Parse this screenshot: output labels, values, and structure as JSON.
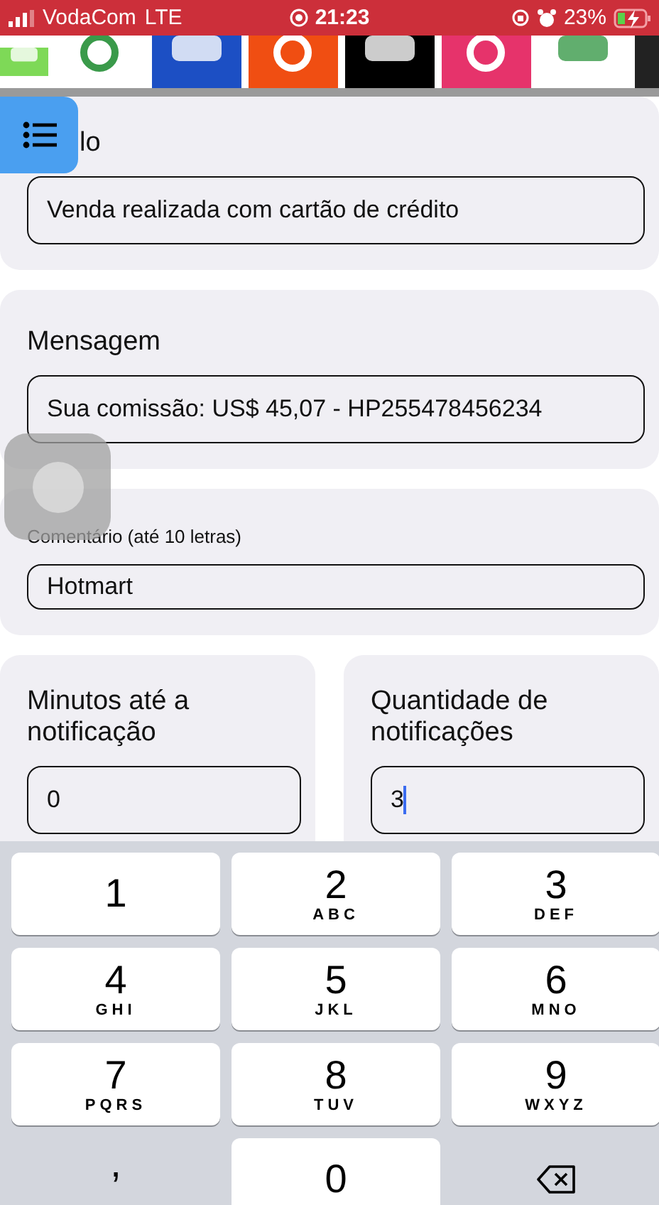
{
  "status_bar": {
    "carrier": "VodaCom",
    "network": "LTE",
    "time": "21:23",
    "battery": "23%",
    "charging": true
  },
  "app_strip": [
    {
      "color": "#7ed957"
    },
    {
      "color": "#ffffff"
    },
    {
      "color": "#1c4fc4"
    },
    {
      "color": "#f04e12"
    },
    {
      "color": "#000000"
    },
    {
      "color": "#e6336b"
    },
    {
      "color": "#ffffff"
    },
    {
      "color": "#222222"
    }
  ],
  "sections": [
    {
      "label": "lo",
      "kind": "title",
      "fields": [
        {
          "value": "Venda realizada com cartão de crédito",
          "focused": false
        }
      ]
    },
    {
      "label": "Mensagem",
      "kind": "title",
      "fields": [
        {
          "value": "Sua comissão: US$ 45,07 - HP255478456234",
          "focused": false
        }
      ]
    },
    {
      "label": "Comentário (até 10 letras)",
      "kind": "caption",
      "fields": [
        {
          "value": "Hotmart",
          "focused": false
        }
      ]
    }
  ],
  "columns": [
    {
      "label": "Minutos até a notificação",
      "value": "0",
      "focused": false
    },
    {
      "label": "Quantidade de notificações",
      "value": "3",
      "focused": true
    }
  ],
  "keyboard": [
    {
      "kind": "digit",
      "digit": "1"
    },
    {
      "kind": "digit",
      "digit": "2",
      "letters": "ABC"
    },
    {
      "kind": "digit",
      "digit": "3",
      "letters": "DEF"
    },
    {
      "kind": "digit",
      "digit": "4",
      "letters": "GHI"
    },
    {
      "kind": "digit",
      "digit": "5",
      "letters": "JKL"
    },
    {
      "kind": "digit",
      "digit": "6",
      "letters": "MNO"
    },
    {
      "kind": "digit",
      "digit": "7",
      "letters": "PQRS"
    },
    {
      "kind": "digit",
      "digit": "8",
      "letters": "TUV"
    },
    {
      "kind": "digit",
      "digit": "9",
      "letters": "WXYZ"
    },
    {
      "kind": "symbol",
      "digit": ","
    },
    {
      "kind": "digit",
      "digit": "0"
    },
    {
      "kind": "delete"
    }
  ]
}
